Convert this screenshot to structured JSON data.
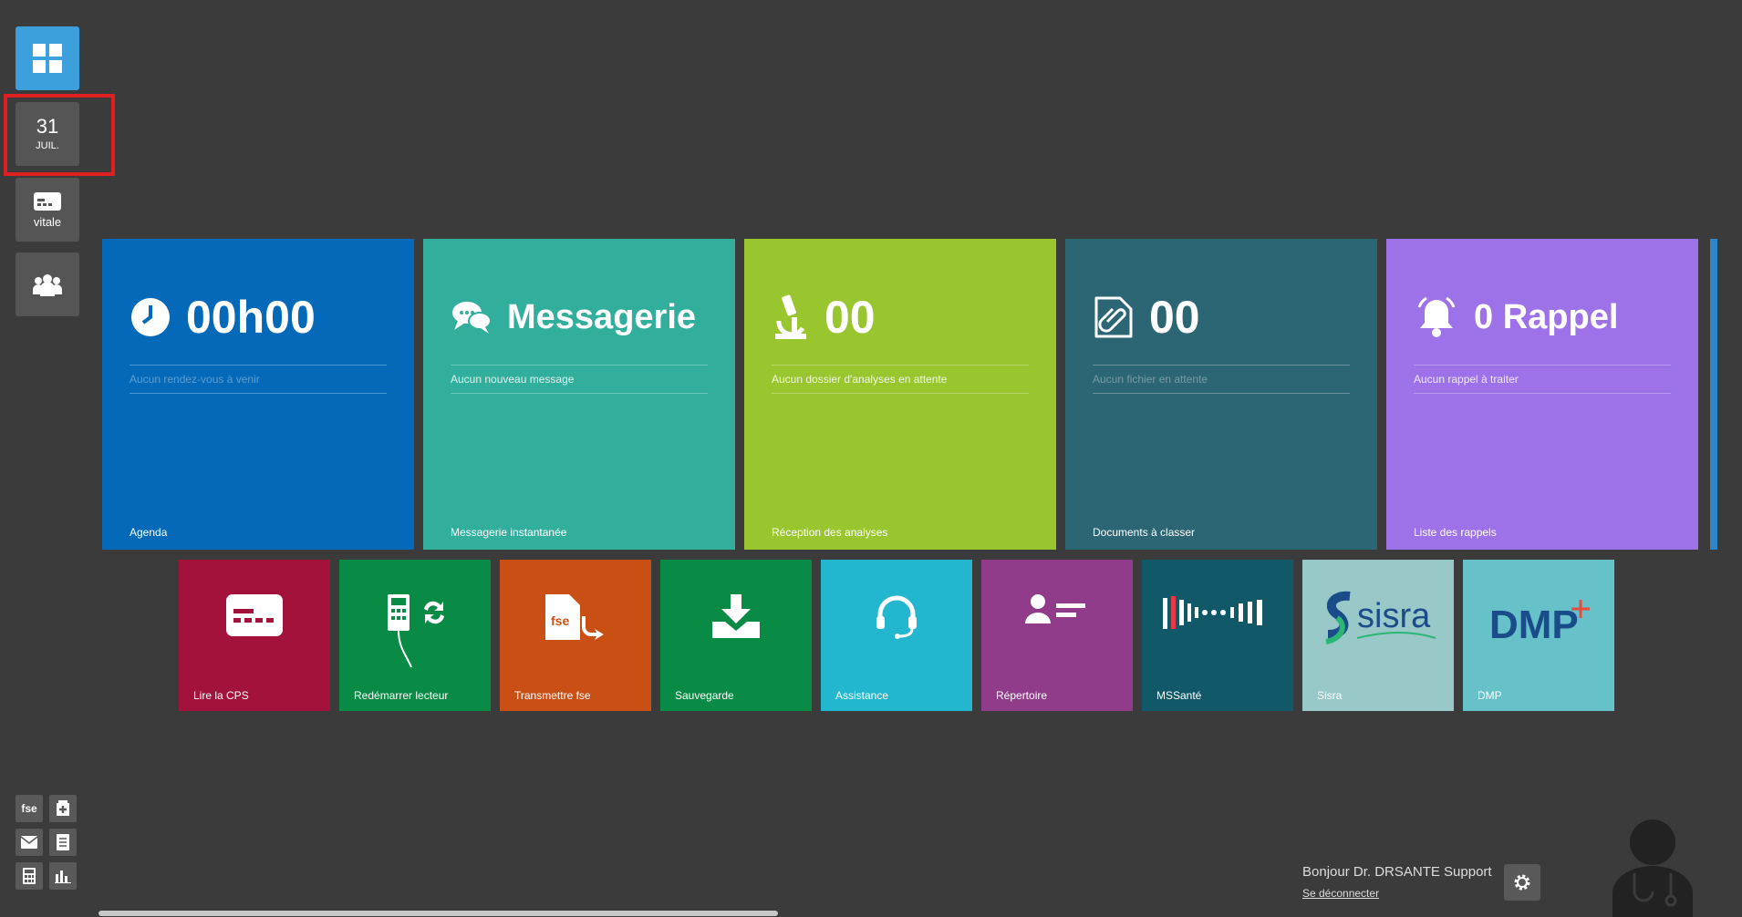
{
  "sidebar": {
    "date": {
      "day": "31",
      "month": "JUIL."
    },
    "vitale_label": "vitale"
  },
  "tiles": {
    "agenda": {
      "value": "00h00",
      "subtitle": "Aucun rendez-vous à venir",
      "footer": "Agenda",
      "color": "#0469b8"
    },
    "messagerie": {
      "value": "Messagerie",
      "subtitle": "Aucun nouveau message",
      "footer": "Messagerie instantanée",
      "color": "#31ae9c"
    },
    "analyses": {
      "value": "00",
      "subtitle": "Aucun dossier d'analyses en attente",
      "footer": "Réception des analyses",
      "color": "#99c52e"
    },
    "documents": {
      "value": "00",
      "subtitle": "Aucun fichier en attente",
      "footer": "Documents à classer",
      "color": "#2c6574"
    },
    "rappels": {
      "value": "0 Rappel",
      "subtitle": "Aucun rappel à traiter",
      "footer": "Liste des rappels",
      "color": "#9d72e8"
    }
  },
  "apps": [
    {
      "label": "Lire la CPS",
      "color": "#a3123a"
    },
    {
      "label": "Redémarrer lecteur",
      "color": "#098b45"
    },
    {
      "label": "Transmettre fse",
      "color": "#ca4f14"
    },
    {
      "label": "Sauvegarde",
      "color": "#098b45"
    },
    {
      "label": "Assistance",
      "color": "#22b7cf"
    },
    {
      "label": "Répertoire",
      "color": "#913c8a"
    },
    {
      "label": "MSSanté",
      "color": "#115869"
    },
    {
      "label": "Sisra",
      "color": "#99c8c8",
      "logo_text": "sisra"
    },
    {
      "label": "DMP",
      "color": "#66c1c8",
      "logo_text": "DMP"
    }
  ],
  "toolbar": {
    "fse_label": "fse"
  },
  "user": {
    "greeting": "Bonjour Dr. DRSANTE Support",
    "logout": "Se déconnecter"
  }
}
